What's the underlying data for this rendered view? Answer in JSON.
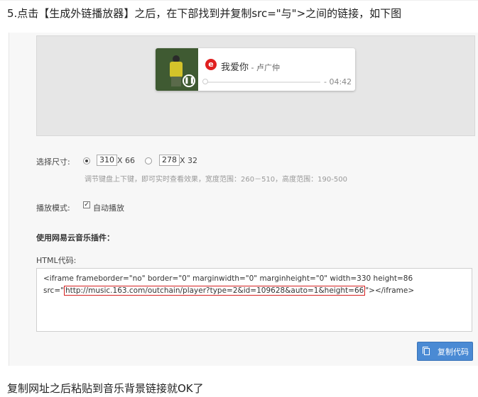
{
  "heading": "5.点击【生成外链播放器】之后，在下部找到并复制src=\"与\">之间的链接，如下图",
  "player": {
    "song_title": "我爱你",
    "artist": " - 卢广仲",
    "duration": "- 04:42",
    "progress": 0
  },
  "size_section": {
    "label": "选择尺寸:",
    "option1_width": "310",
    "option1_height": "X 66",
    "option2_width": "278",
    "option2_height": "X 32",
    "hint": "调节键盘上下键，即可实时查看效果，宽度范围：260－510，高度范围：190-500"
  },
  "mode_section": {
    "label": "播放模式:",
    "autoplay_label": "自动播放",
    "autoplay_checked": true
  },
  "plugin_title": "使用网易云音乐插件：",
  "html_code_label": "HTML代码:",
  "code": {
    "line1": "<iframe frameborder=\"no\" border=\"0\" marginwidth=\"0\" marginheight=\"0\" width=330 height=86",
    "line2_prefix": "src=\"",
    "url": "http://music.163.com/outchain/player?type=2&id=109628&auto=1&height=66",
    "line2_suffix": "\"></iframe>"
  },
  "copy_button_label": "复制代码",
  "footer": "复制网址之后粘贴到音乐背景链接就OK了"
}
